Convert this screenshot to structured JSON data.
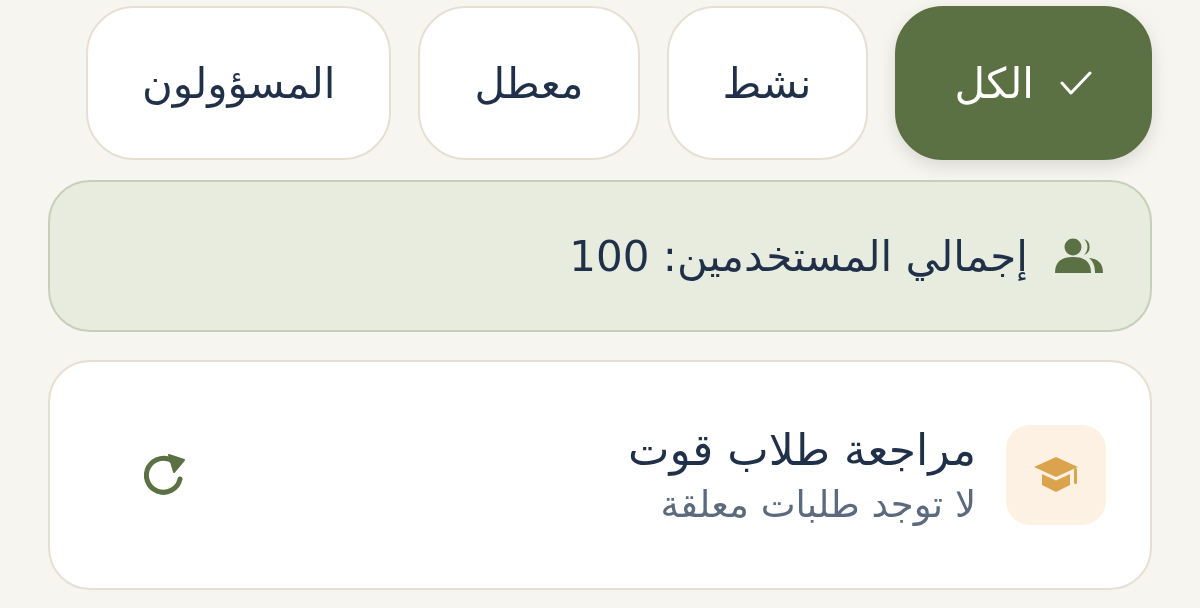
{
  "filters": [
    {
      "label": "الكل",
      "selected": true
    },
    {
      "label": "نشط",
      "selected": false
    },
    {
      "label": "معطل",
      "selected": false
    },
    {
      "label": "المسؤولون",
      "selected": false
    }
  ],
  "summary": {
    "text": "إجمالي المستخدمين: 100"
  },
  "review_card": {
    "title": "مراجعة طلاب قوت",
    "subtitle": "لا توجد طلبات معلقة"
  }
}
